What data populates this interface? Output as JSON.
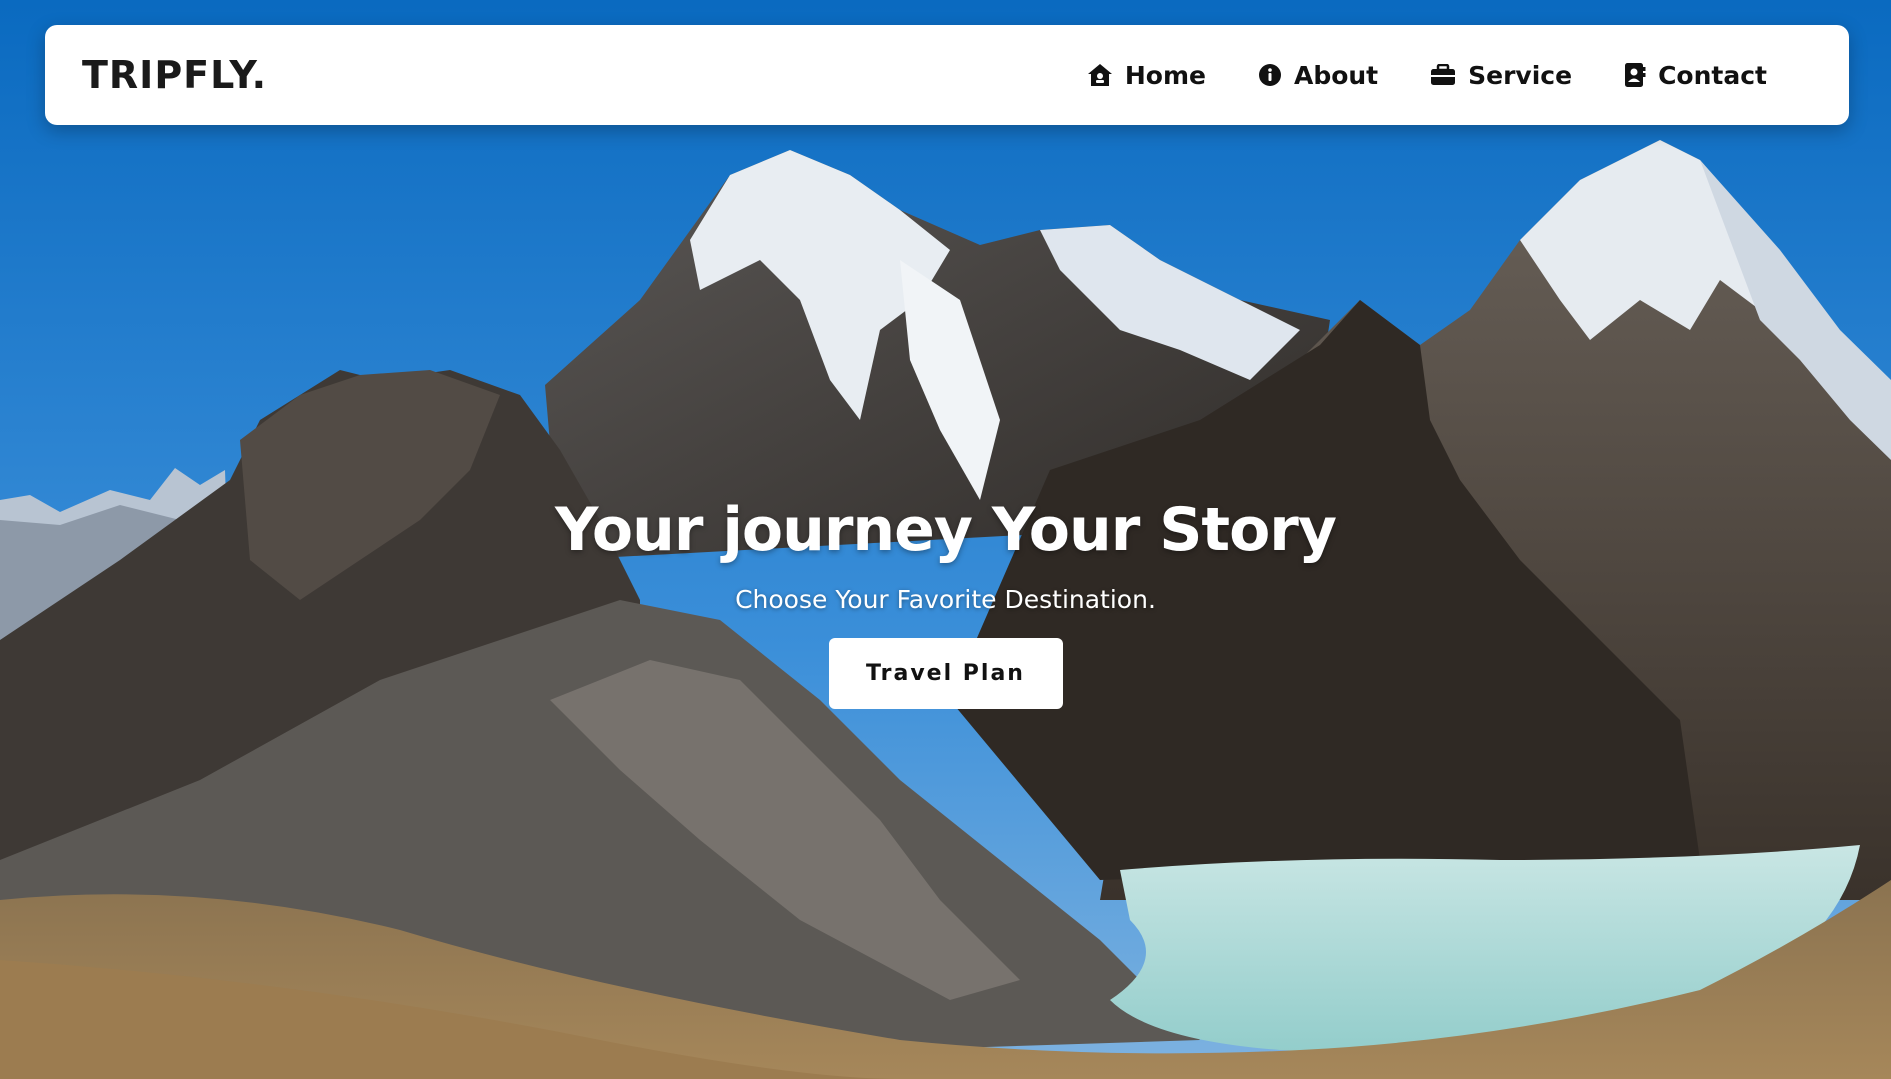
{
  "brand": {
    "name": "TRIPFLY."
  },
  "nav": {
    "items": [
      {
        "label": "Home",
        "icon": "home-icon"
      },
      {
        "label": "About",
        "icon": "info-icon"
      },
      {
        "label": "Service",
        "icon": "briefcase-icon"
      },
      {
        "label": "Contact",
        "icon": "contact-card-icon"
      }
    ]
  },
  "hero": {
    "title": "Your journey Your Story",
    "subtitle": "Choose Your Favorite Destination.",
    "cta_label": "Travel Plan",
    "background_image": "snow-capped mountain range with glacial lake"
  },
  "colors": {
    "sky": "#0b6fc0",
    "navbar_bg": "#ffffff",
    "text_dark": "#111111",
    "hero_text": "#ffffff",
    "lake": "#9fd3d3",
    "ground": "#a08456"
  }
}
